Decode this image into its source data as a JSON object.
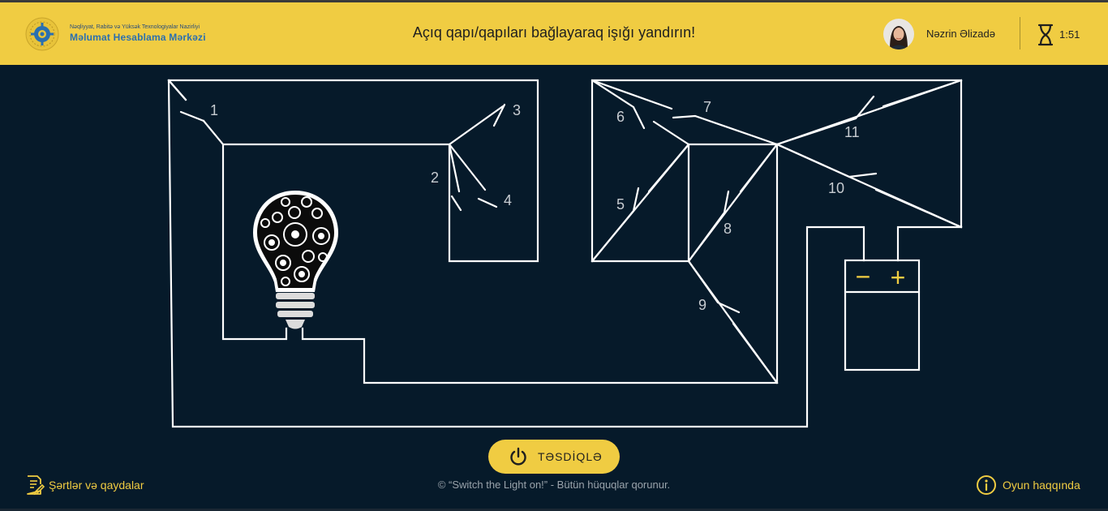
{
  "header": {
    "org_subtitle": "Nəqliyyat, Rabitə və Yüksək Texnologiyalar Nazirliyi",
    "org_name": "Məlumat Hesablama Mərkəzi",
    "title": "Açıq qapı/qapıları bağlayaraq işığı yandırın!",
    "user_name": "Nəzrin Əlizadə",
    "timer": "1:51"
  },
  "switches": [
    {
      "label": "1"
    },
    {
      "label": "2"
    },
    {
      "label": "3"
    },
    {
      "label": "4"
    },
    {
      "label": "5"
    },
    {
      "label": "6"
    },
    {
      "label": "7"
    },
    {
      "label": "8"
    },
    {
      "label": "9"
    },
    {
      "label": "10"
    },
    {
      "label": "11"
    }
  ],
  "battery": {
    "minus": "−",
    "plus": "+"
  },
  "footer": {
    "confirm_label": "TƏSDİQLƏ",
    "rules_label": "Şərtlər və qaydalar",
    "copyright": "© “Switch the Light on!” - Bütün hüquqlar qorunur.",
    "about_label": "Oyun haqqında"
  },
  "colors": {
    "background": "#061a2a",
    "accent": "#f0cc42",
    "wire": "#ffffff",
    "label": "#c7ccd1"
  },
  "icons": [
    "ministry-logo-icon",
    "hourglass-icon",
    "power-icon",
    "document-edit-icon",
    "info-icon",
    "bulb-icon",
    "battery-icon"
  ]
}
